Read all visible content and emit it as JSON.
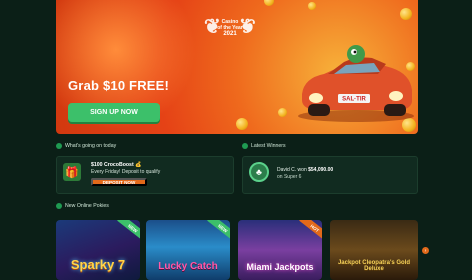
{
  "hero": {
    "award_line1": "Casino",
    "award_line2": "of the Year",
    "award_year": "2021",
    "title": "Grab $10 FREE!",
    "cta_label": "SIGN UP NOW",
    "plate_text": "SAL·TIR"
  },
  "whats_going_on": {
    "heading": "What's going on today",
    "promo_title": "$100 CrocoBoost 💰",
    "promo_desc": "Every Friday! Deposit to qualify",
    "deposit_label": "DEPOSIT NOW"
  },
  "latest_winners": {
    "heading": "Latest Winners",
    "winner_prefix": "David C. won",
    "winner_amount": "$54,090.00",
    "winner_game": "on Super 6"
  },
  "new_pokies": {
    "heading": "New Online Pokies",
    "games": [
      {
        "name": "Sparky 7",
        "badge": "NEW"
      },
      {
        "name": "Lucky Catch",
        "badge": "NEW"
      },
      {
        "name": "Miami Jackpots",
        "badge": "HOT"
      },
      {
        "name": "Jackpot Cleopatra's Gold Deluxe",
        "badge": ""
      }
    ]
  },
  "colors": {
    "background": "#0b1f17",
    "accent_green": "#3cc06a",
    "accent_orange": "#e2691a",
    "hero_orange": "#e54216"
  }
}
